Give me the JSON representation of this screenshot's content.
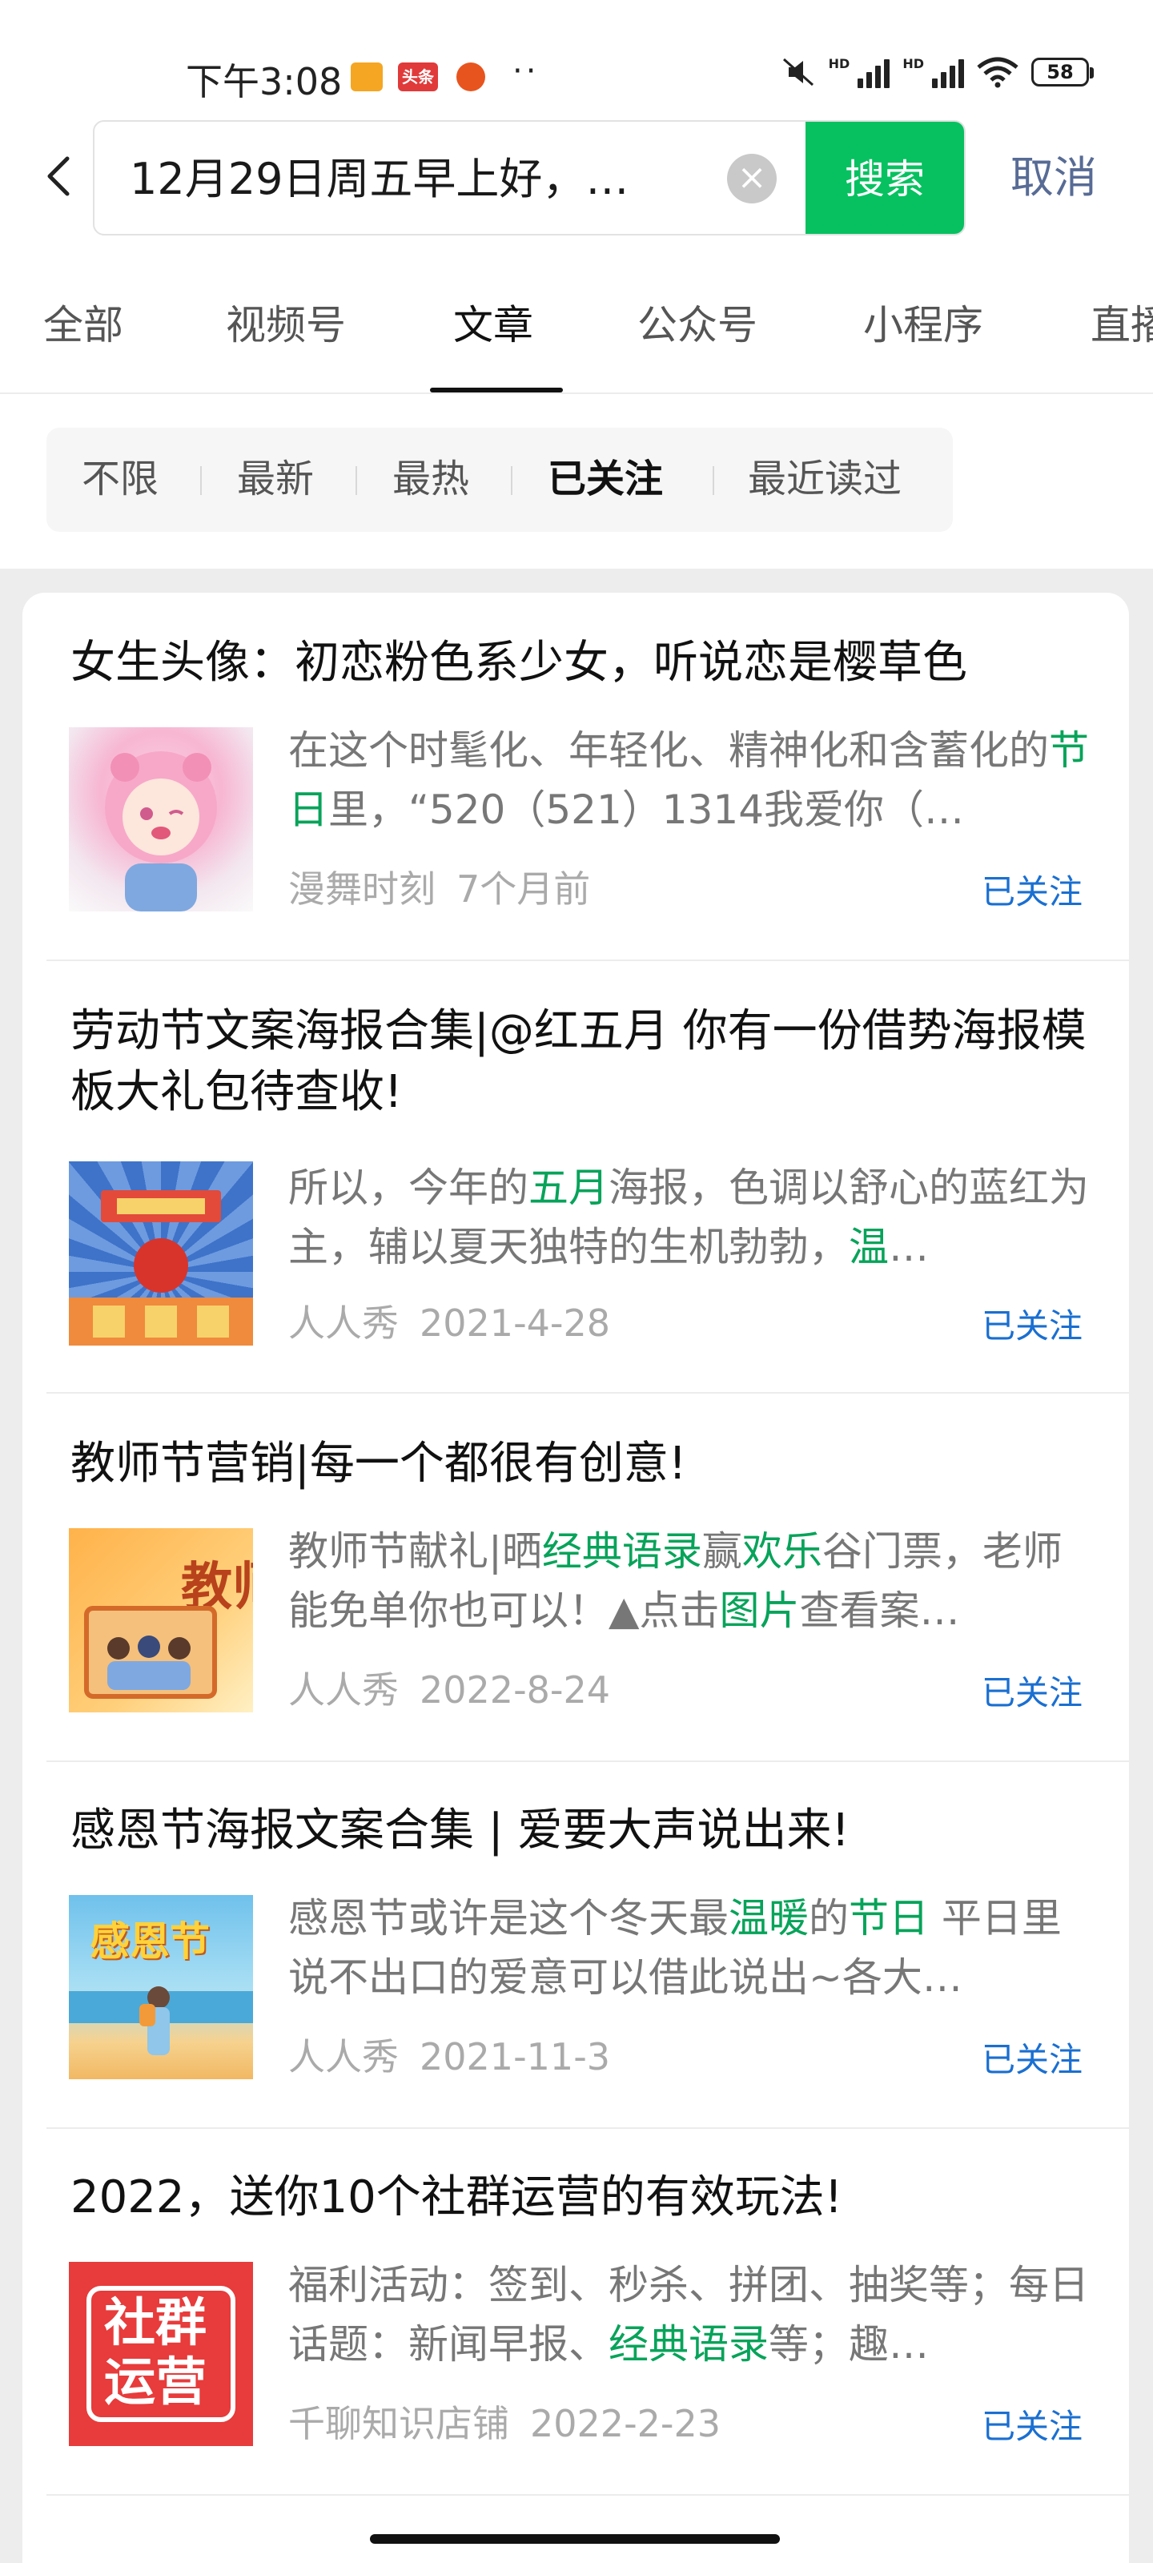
{
  "status_bar": {
    "time": "下午3:08",
    "app_badge": "头条",
    "battery": "58",
    "hd1": "HD",
    "hd2": "HD"
  },
  "search": {
    "query": "12月29日周五早上好，…",
    "search_label": "搜索",
    "cancel_label": "取消"
  },
  "tabs": [
    "全部",
    "视频号",
    "文章",
    "公众号",
    "小程序",
    "直播"
  ],
  "active_tab": "文章",
  "filters": [
    "不限",
    "最新",
    "最热",
    "已关注",
    "最近读过"
  ],
  "active_filter": "已关注",
  "results": [
    {
      "title": "女生头像：初恋粉色系少女，听说恋是樱草色",
      "snippet_parts": [
        {
          "text": "在这个时髦化、年轻化、精神化和含蓄化的",
          "hl": false
        },
        {
          "text": "节日",
          "hl": true
        },
        {
          "text": "里，“520（521）1314我爱你（…",
          "hl": false
        }
      ],
      "source": "漫舞时刻",
      "date": "7个月前",
      "follow": "已关注",
      "thumb_icon": "anime-girl-thumbnail"
    },
    {
      "title": "劳动节文案海报合集|@红五月 你有一份借势海报模板大礼包待查收!",
      "snippet_parts": [
        {
          "text": "所以，今年的",
          "hl": false
        },
        {
          "text": "五月",
          "hl": true
        },
        {
          "text": "海报，色调以舒心的蓝红为主，辅以夏天独特的生机勃勃，",
          "hl": false
        },
        {
          "text": "温",
          "hl": true
        },
        {
          "text": "…",
          "hl": false
        }
      ],
      "source": "人人秀",
      "date": "2021-4-28",
      "follow": "已关注",
      "thumb_icon": "labor-day-poster-thumbnail"
    },
    {
      "title": "教师节营销|每一个都很有创意!",
      "snippet_parts": [
        {
          "text": "教师节献礼|晒",
          "hl": false
        },
        {
          "text": "经典语录",
          "hl": true
        },
        {
          "text": "赢",
          "hl": false
        },
        {
          "text": "欢乐",
          "hl": true
        },
        {
          "text": "谷门票，老师能免单你也可以！▲点击",
          "hl": false
        },
        {
          "text": "图片",
          "hl": true
        },
        {
          "text": "查看案…",
          "hl": false
        }
      ],
      "source": "人人秀",
      "date": "2022-8-24",
      "follow": "已关注",
      "thumb_icon": "teachers-day-thumbnail",
      "thumb_text": "教师"
    },
    {
      "title": "感恩节海报文案合集 | 爱要大声说出来!",
      "snippet_parts": [
        {
          "text": "感恩节或许是这个冬天最",
          "hl": false
        },
        {
          "text": "温暖",
          "hl": true
        },
        {
          "text": "的",
          "hl": false
        },
        {
          "text": "节日",
          "hl": true
        },
        {
          "text": " 平日里说不出口的爱意可以借此说出~各大…",
          "hl": false
        }
      ],
      "source": "人人秀",
      "date": "2021-11-3",
      "follow": "已关注",
      "thumb_icon": "thanksgiving-beach-thumbnail",
      "thumb_text": "感恩节"
    },
    {
      "title": "2022，送你10个社群运营的有效玩法!",
      "snippet_parts": [
        {
          "text": "福利活动：签到、秒杀、拼团、抽奖等；每日话题：新闻早报、",
          "hl": false
        },
        {
          "text": "经典语录",
          "hl": true
        },
        {
          "text": "等；趣…",
          "hl": false
        }
      ],
      "source": "千聊知识店铺",
      "date": "2022-2-23",
      "follow": "已关注",
      "thumb_icon": "community-ops-thumbnail",
      "thumb_text_lines": [
        "社群",
        "运营"
      ]
    }
  ]
}
